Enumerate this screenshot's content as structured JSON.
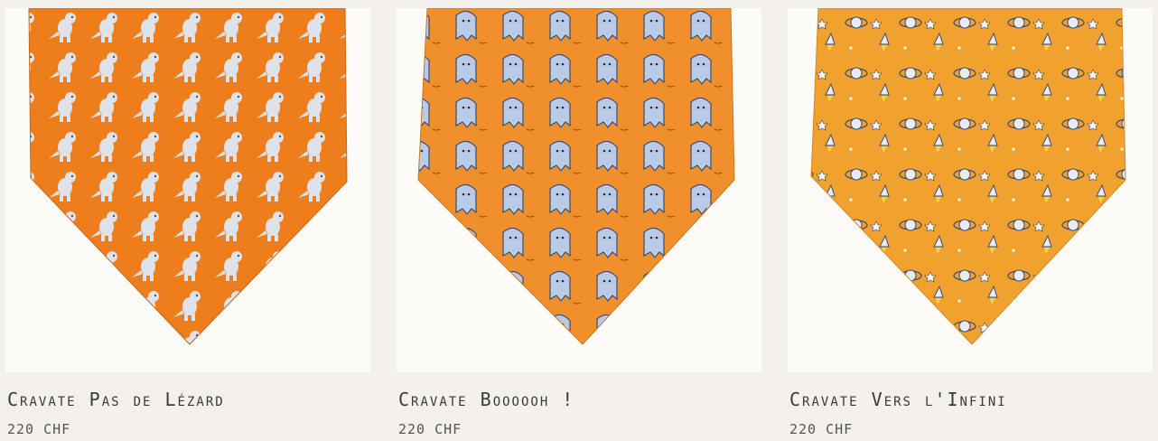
{
  "products": [
    {
      "name": "Cravate Pas de Lézard",
      "price": "220 CHF",
      "pattern_icon": "dinosaur-icon",
      "colors": {
        "base": "#ee7d1c",
        "motif": "#d9dde6"
      }
    },
    {
      "name": "Cravate Boooooh !",
      "price": "220 CHF",
      "pattern_icon": "ghost-icon",
      "colors": {
        "base": "#f0902c",
        "motif": "#b7c8e4"
      }
    },
    {
      "name": "Cravate Vers l'Infini",
      "price": "220 CHF",
      "pattern_icon": "rocket-icon",
      "colors": {
        "base": "#f0a12e",
        "motif": "#e8ecf2"
      }
    }
  ]
}
